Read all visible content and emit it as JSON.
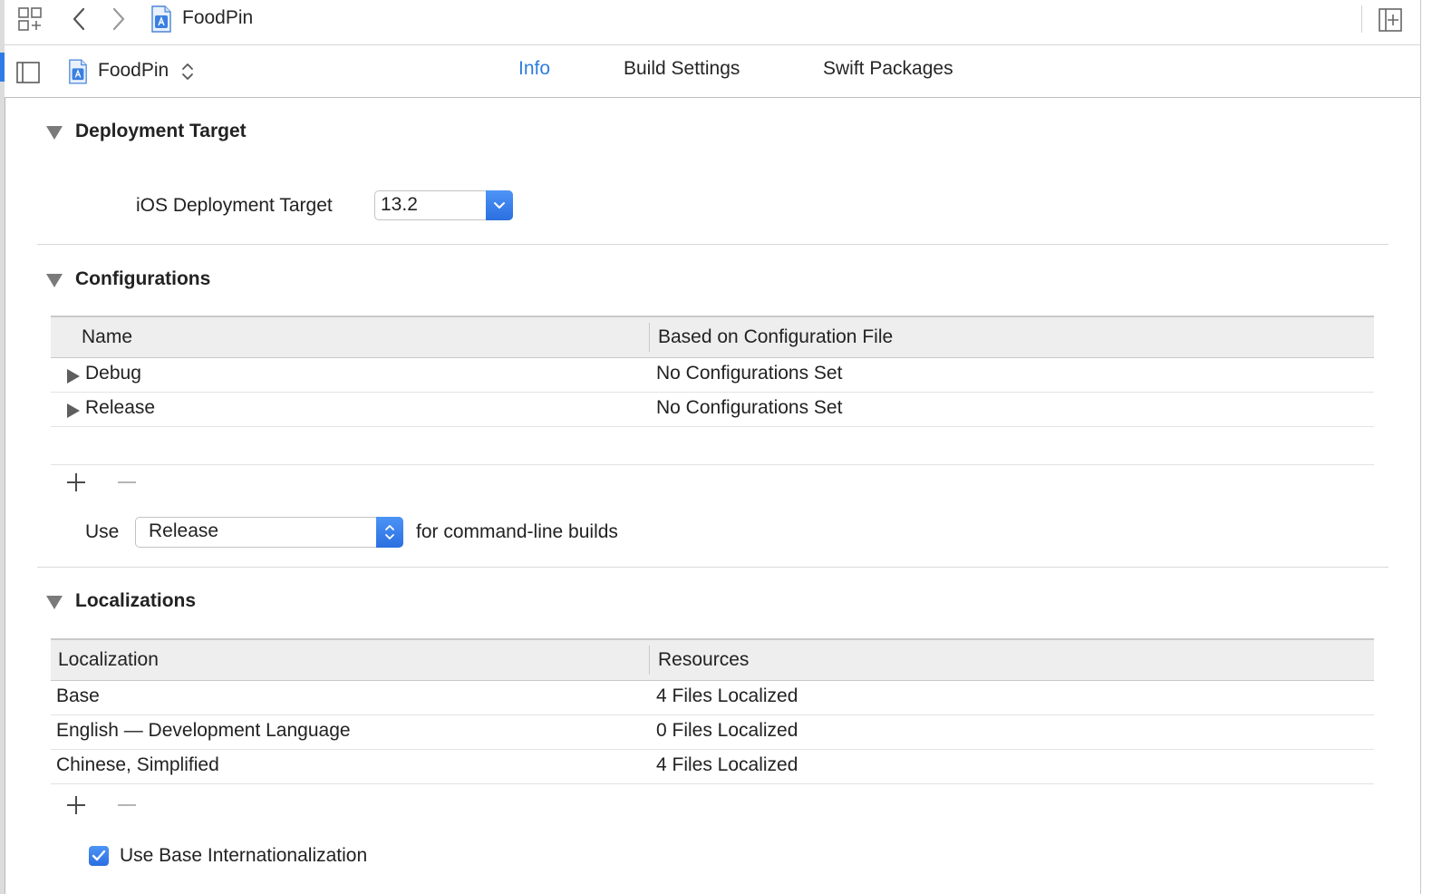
{
  "toolbar": {
    "breadcrumb": "FoodPin"
  },
  "editor_bar": {
    "target_name": "FoodPin",
    "tabs": [
      {
        "label": "Info",
        "active": true
      },
      {
        "label": "Build Settings",
        "active": false
      },
      {
        "label": "Swift Packages",
        "active": false
      }
    ]
  },
  "deployment": {
    "title": "Deployment Target",
    "label": "iOS Deployment Target",
    "value": "13.2"
  },
  "configurations": {
    "title": "Configurations",
    "columns": [
      "Name",
      "Based on Configuration File"
    ],
    "rows": [
      {
        "name": "Debug",
        "file": "No Configurations Set"
      },
      {
        "name": "Release",
        "file": "No Configurations Set"
      }
    ],
    "use_label": "Use",
    "use_value": "Release",
    "use_suffix": "for command-line builds"
  },
  "localizations": {
    "title": "Localizations",
    "columns": [
      "Localization",
      "Resources"
    ],
    "rows": [
      {
        "name": "Base",
        "resources": "4 Files Localized"
      },
      {
        "name": "English — Development Language",
        "resources": "0 Files Localized"
      },
      {
        "name": "Chinese, Simplified",
        "resources": "4 Files Localized"
      }
    ],
    "base_i18n_label": "Use Base Internationalization",
    "base_i18n_checked": true
  },
  "colors": {
    "accent": "#2f7ddf",
    "header_bg": "#eeeeee"
  },
  "icons": [
    "grid-icon",
    "back-icon",
    "forward-icon",
    "project-file-icon",
    "add-editor-icon",
    "sidebar-toggle-icon",
    "stepper-icon",
    "chevron-down-icon",
    "plus-icon",
    "minus-icon",
    "checkmark-icon"
  ]
}
